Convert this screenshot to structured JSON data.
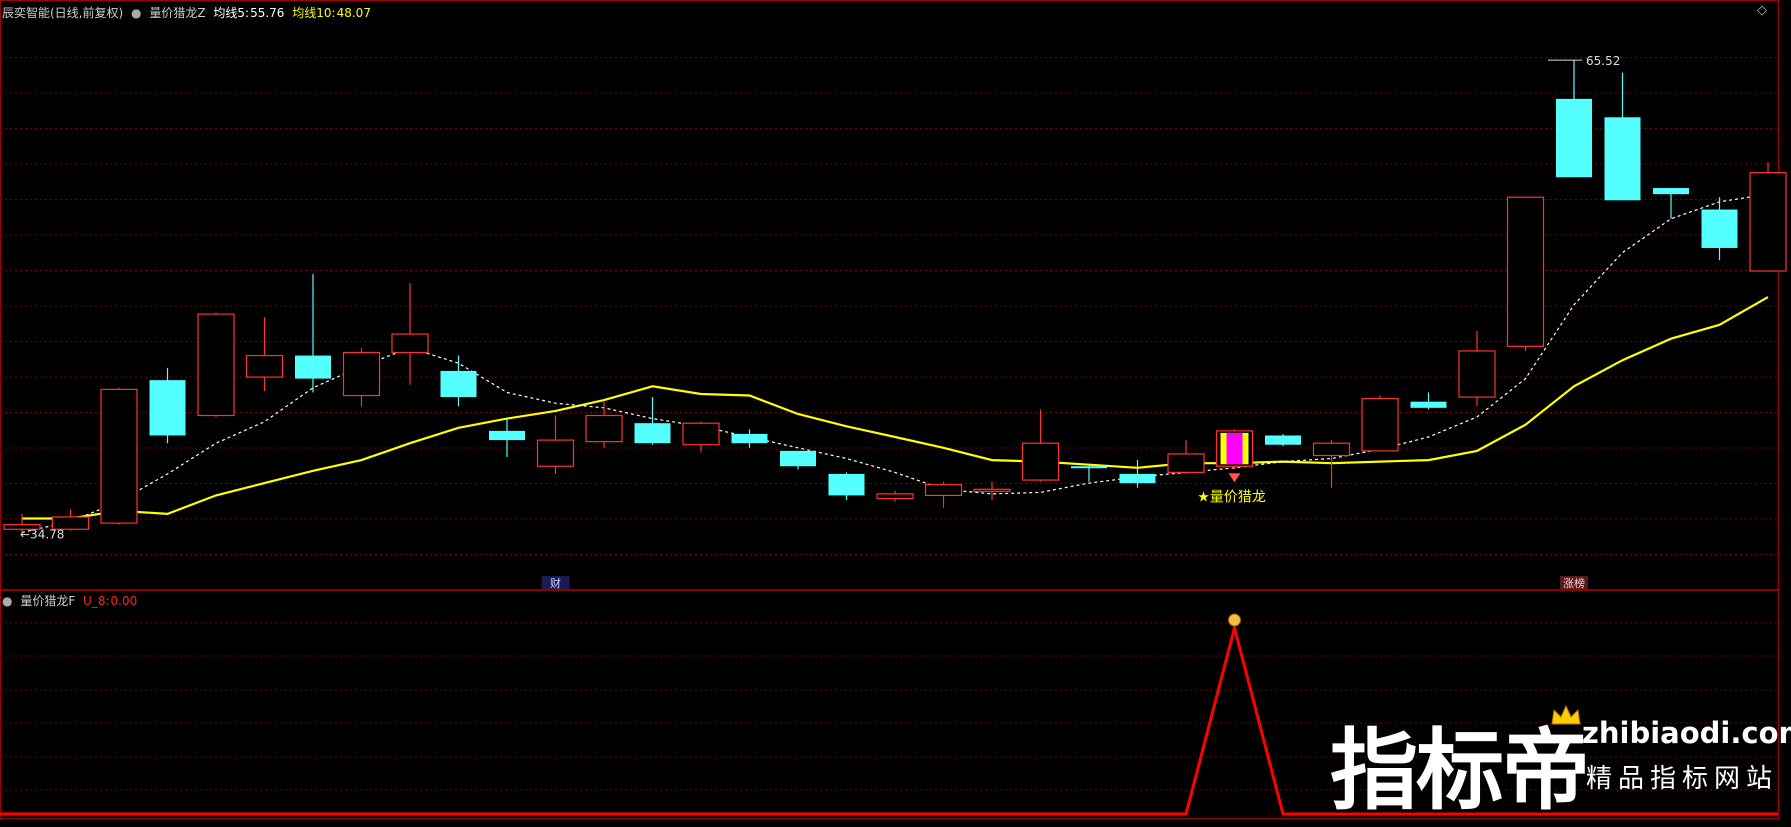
{
  "header": {
    "stock_name": "辰奕智能(日线,前复权)",
    "indicator_main": "量价猎龙Z",
    "ma5_label": "均线5:",
    "ma5_value": "55.76",
    "ma10_label": "均线10:",
    "ma10_value": "48.07"
  },
  "sub_header": {
    "indicator": "量价猎龙F",
    "u_label": "U_8:",
    "u_value": "0.00"
  },
  "corner_icon": "◇",
  "annotations": {
    "low_label": "←34.78",
    "high_label": "65.52",
    "signal_label": "★量价猎龙",
    "marker_cai": "财",
    "marker_zhangting": "涨榜"
  },
  "watermark": {
    "brand": "指标帝",
    "url": "zhibiaodi.com",
    "tagline": "精品指标网站"
  },
  "colors": {
    "up": "#ff3232",
    "down": "#54ffff",
    "ma5": "#ffffff",
    "ma10": "#ffff00",
    "grid": "#7a0000",
    "signal_up": "#ff00ff",
    "signal_bar": "#ffff00",
    "sub_line": "#ff0000"
  },
  "chart_data": {
    "type": "candlestick",
    "price_range": [
      33,
      68
    ],
    "candles": [
      {
        "o": 35.0,
        "h": 36.0,
        "l": 34.78,
        "c": 35.3
      },
      {
        "o": 35.0,
        "h": 36.3,
        "l": 34.9,
        "c": 35.8
      },
      {
        "o": 35.4,
        "h": 44.2,
        "l": 35.3,
        "c": 44.1
      },
      {
        "o": 44.7,
        "h": 45.5,
        "l": 40.6,
        "c": 41.1
      },
      {
        "o": 42.4,
        "h": 49.1,
        "l": 42.3,
        "c": 49.0
      },
      {
        "o": 44.9,
        "h": 48.8,
        "l": 44.0,
        "c": 46.3
      },
      {
        "o": 46.3,
        "h": 51.6,
        "l": 43.9,
        "c": 44.8
      },
      {
        "o": 43.7,
        "h": 46.8,
        "l": 43.0,
        "c": 46.5
      },
      {
        "o": 46.5,
        "h": 51.0,
        "l": 44.4,
        "c": 47.7
      },
      {
        "o": 45.3,
        "h": 46.3,
        "l": 43.0,
        "c": 43.6
      },
      {
        "o": 41.4,
        "h": 42.2,
        "l": 39.7,
        "c": 40.8
      },
      {
        "o": 39.1,
        "h": 42.4,
        "l": 38.6,
        "c": 40.8
      },
      {
        "o": 40.7,
        "h": 43.3,
        "l": 40.3,
        "c": 42.4
      },
      {
        "o": 41.9,
        "h": 43.6,
        "l": 40.5,
        "c": 40.6
      },
      {
        "o": 40.5,
        "h": 42.0,
        "l": 40.0,
        "c": 41.9
      },
      {
        "o": 41.2,
        "h": 41.5,
        "l": 40.3,
        "c": 40.6
      },
      {
        "o": 40.1,
        "h": 40.1,
        "l": 38.9,
        "c": 39.1
      },
      {
        "o": 38.6,
        "h": 38.7,
        "l": 36.9,
        "c": 37.2
      },
      {
        "o": 37.0,
        "h": 37.5,
        "l": 36.8,
        "c": 37.3
      },
      {
        "o": 37.2,
        "h": 38.1,
        "l": 36.4,
        "c": 37.9
      },
      {
        "o": 37.5,
        "h": 38.1,
        "l": 36.9,
        "c": 37.6
      },
      {
        "o": 38.2,
        "h": 42.8,
        "l": 38.1,
        "c": 40.6
      },
      {
        "o": 39.1,
        "h": 39.2,
        "l": 38.1,
        "c": 39.0
      },
      {
        "o": 38.6,
        "h": 39.5,
        "l": 37.7,
        "c": 38.0
      },
      {
        "o": 38.7,
        "h": 40.8,
        "l": 38.6,
        "c": 39.9
      },
      {
        "o": 39.1,
        "h": 41.5,
        "l": 38.9,
        "c": 41.4
      },
      {
        "o": 41.1,
        "h": 41.2,
        "l": 40.4,
        "c": 40.5
      },
      {
        "o": 39.8,
        "h": 40.8,
        "l": 37.7,
        "c": 40.6
      },
      {
        "o": 40.1,
        "h": 43.7,
        "l": 40.1,
        "c": 43.5
      },
      {
        "o": 43.3,
        "h": 43.9,
        "l": 42.8,
        "c": 42.9
      },
      {
        "o": 43.6,
        "h": 47.9,
        "l": 43.0,
        "c": 46.6
      },
      {
        "o": 46.9,
        "h": 56.6,
        "l": 46.6,
        "c": 56.6
      },
      {
        "o": 63.0,
        "h": 65.52,
        "l": 57.9,
        "c": 57.9
      },
      {
        "o": 61.8,
        "h": 64.7,
        "l": 58.4,
        "c": 56.4
      },
      {
        "o": 57.2,
        "h": 57.2,
        "l": 55.2,
        "c": 56.8
      },
      {
        "o": 55.8,
        "h": 56.6,
        "l": 52.5,
        "c": 53.3
      },
      {
        "o": 51.8,
        "h": 58.9,
        "l": 52.7,
        "c": 58.2
      }
    ],
    "ma5": [
      34.8,
      35.5,
      36.8,
      38.6,
      40.6,
      42.0,
      44.2,
      45.6,
      46.8,
      45.8,
      43.9,
      43.2,
      42.9,
      42.2,
      41.7,
      41.0,
      40.3,
      39.6,
      38.7,
      37.6,
      37.3,
      37.4,
      38.0,
      38.4,
      38.7,
      39.0,
      39.4,
      39.6,
      40.2,
      41.0,
      42.3,
      44.8,
      49.6,
      53.0,
      55.2,
      56.3,
      56.8
    ],
    "ma10": [
      35.7,
      35.7,
      36.2,
      36.0,
      37.2,
      38.0,
      38.8,
      39.5,
      40.6,
      41.6,
      42.2,
      42.7,
      43.4,
      44.3,
      43.8,
      43.7,
      42.5,
      41.7,
      41.0,
      40.3,
      39.5,
      39.4,
      39.2,
      39.0,
      39.3,
      39.3,
      39.4,
      39.3,
      39.4,
      39.5,
      40.1,
      41.8,
      44.3,
      46.0,
      47.4,
      48.3,
      50.1
    ],
    "signal_index": 25,
    "sub_values": [
      0,
      0,
      0,
      0,
      0,
      0,
      0,
      0,
      0,
      0,
      0,
      0,
      0,
      0,
      0,
      0,
      0,
      0,
      0,
      0,
      0,
      0,
      0,
      0,
      0,
      1,
      0,
      0,
      0,
      0,
      0,
      0,
      0,
      0,
      0,
      0,
      0
    ],
    "cai_index": 11,
    "zhangting_index": 32
  }
}
